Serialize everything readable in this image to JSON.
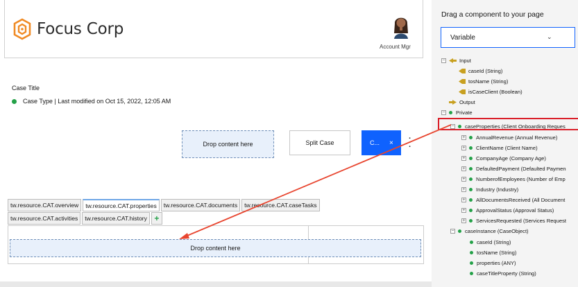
{
  "header": {
    "brand": "Focus Corp",
    "account_label": "Account Mgr"
  },
  "case": {
    "title": "Case Title",
    "type_line": "Case Type | Last modified on Oct 15, 2022, 12:05 AM"
  },
  "actions": {
    "drop_top": "Drop content here",
    "split_case": "Split Case",
    "blue_button": "C...",
    "blue_close": "×",
    "kebab": "⋮"
  },
  "tabs": {
    "row1": [
      "tw.resource.CAT.overview",
      "tw.resource.CAT.properties",
      "tw.resource.CAT.documents",
      "tw.resource.CAT.caseTasks"
    ],
    "row2": [
      "tw.resource.CAT.activities",
      "tw.resource.CAT.history"
    ],
    "plus": "+",
    "drop_bottom": "Drop content here"
  },
  "palette": {
    "heading": "Drag a component to your page",
    "select_value": "Variable",
    "tree": {
      "input": "Input",
      "input_items": [
        "caseId (String)",
        "tosName (String)",
        "isCaseClient (Boolean)"
      ],
      "output": "Output",
      "private": "Private",
      "case_properties": "caseProperties (Client Onboarding Reques",
      "case_properties_items": [
        "AnnualRevenue (Annual Revenue)",
        "ClientName (Client Name)",
        "CompanyAge (Company Age)",
        "DefaultedPayment (Defaulted Paymen",
        "NumberofEmployees (Number of Emp",
        "Industry (Industry)",
        "AllDocumentsReceived (All Document",
        "ApprovalStatus (Approval Status)",
        "ServicesRequested (Services Request"
      ],
      "case_instance": "caseInstance (CaseObject)",
      "case_instance_items": [
        "caseId (String)",
        "tosName (String)",
        "properties (ANY)",
        "caseTitleProperty (String)"
      ]
    }
  },
  "colors": {
    "accent_blue": "#0f62fe",
    "status_green": "#24a148",
    "highlight_red": "#da1e28",
    "logo_orange": "#f08a24"
  }
}
